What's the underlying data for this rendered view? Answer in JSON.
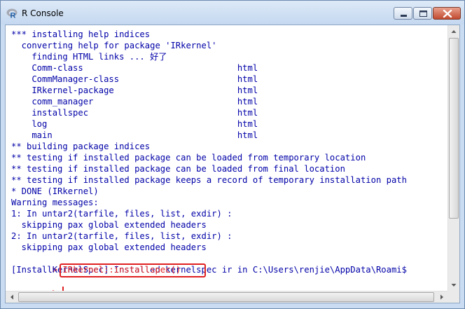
{
  "window": {
    "title": "R Console"
  },
  "console": {
    "lines": [
      "*** installing help indices",
      "  converting help for package 'IRkernel'",
      "    finding HTML links ... 好了",
      "    Comm-class                              html",
      "    CommManager-class                       html",
      "    IRkernel-package                        html",
      "    comm_manager                            html",
      "    installspec                             html",
      "    log                                     html",
      "    main                                    html",
      "** building package indices",
      "** testing if installed package can be loaded from temporary location",
      "** testing if installed package can be loaded from final location",
      "** testing if installed package keeps a record of temporary installation path",
      "* DONE (IRkernel)",
      "Warning messages:",
      "1: In untar2(tarfile, files, list, exdir) :",
      "  skipping pax global extended headers",
      "2: In untar2(tarfile, files, list, exdir) :",
      "  skipping pax global extended headers"
    ],
    "command": {
      "prompt": ">",
      "text": "IRkernel::installspec()"
    },
    "output_line": "[InstallKernelSpec] Installed kernelspec ir in C:\\Users\\renjie\\AppData\\Roami$",
    "input_prompt": ">",
    "colors": {
      "output": "#0000a8",
      "input": "#e02020",
      "highlight_box": "#e02020"
    }
  },
  "icons": {
    "app": "r-logo-icon",
    "minimize": "minimize-icon",
    "maximize": "maximize-icon",
    "close": "close-icon"
  }
}
